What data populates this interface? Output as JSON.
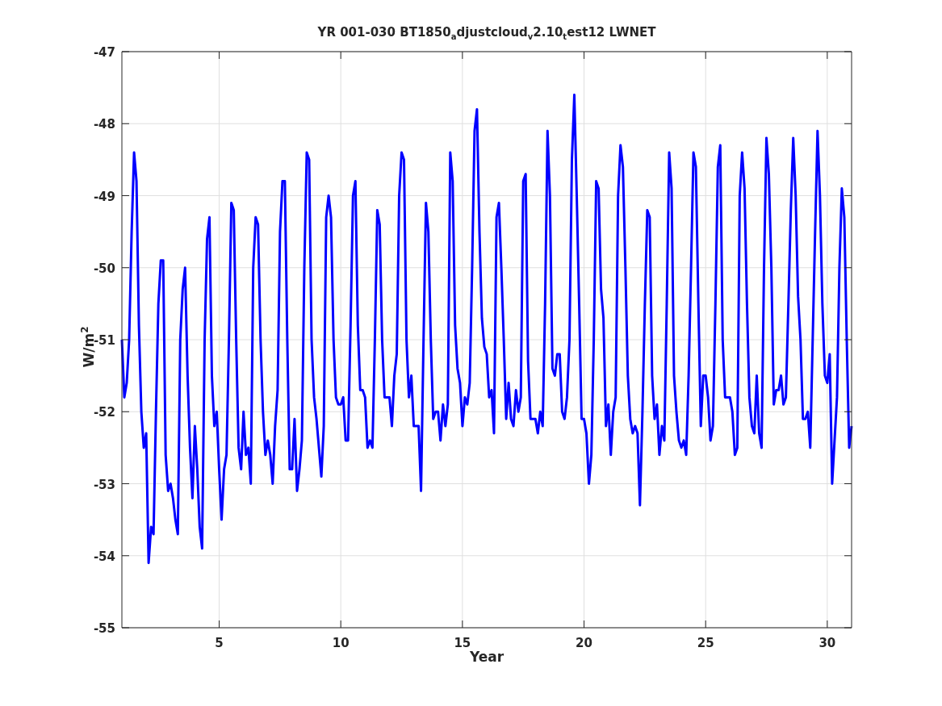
{
  "figure": {
    "chart_data": {
      "type": "line",
      "title": "YR 001-030 BT1850$_{a}$djustcloud$_{v}$2.10$_{t}$est12 LWNET",
      "xlabel": "Year",
      "ylabel": "W/m$^{2}$",
      "xlim": [
        1,
        31
      ],
      "ylim": [
        -55,
        -47
      ],
      "xticks": [
        5,
        10,
        15,
        20,
        25,
        30
      ],
      "yticks": [
        -55,
        -54,
        -53,
        -52,
        -51,
        -50,
        -49,
        -48,
        -47
      ],
      "x": [
        1.0,
        1.1,
        1.2,
        1.3,
        1.4,
        1.5,
        1.6,
        1.7,
        1.8,
        1.9,
        2.0,
        2.1,
        2.2,
        2.3,
        2.4,
        2.5,
        2.6,
        2.7,
        2.8,
        2.9,
        3.0,
        3.1,
        3.2,
        3.3,
        3.4,
        3.5,
        3.6,
        3.7,
        3.8,
        3.9,
        4.0,
        4.1,
        4.2,
        4.3,
        4.4,
        4.5,
        4.6,
        4.7,
        4.8,
        4.9,
        5.0,
        5.1,
        5.2,
        5.3,
        5.4,
        5.5,
        5.6,
        5.7,
        5.8,
        5.9,
        6.0,
        6.1,
        6.2,
        6.3,
        6.4,
        6.5,
        6.6,
        6.7,
        6.8,
        6.9,
        7.0,
        7.1,
        7.2,
        7.3,
        7.4,
        7.5,
        7.6,
        7.7,
        7.8,
        7.9,
        8.0,
        8.1,
        8.2,
        8.3,
        8.4,
        8.5,
        8.6,
        8.7,
        8.8,
        8.9,
        9.0,
        9.1,
        9.2,
        9.3,
        9.4,
        9.5,
        9.6,
        9.7,
        9.8,
        9.9,
        10.0,
        10.1,
        10.2,
        10.3,
        10.4,
        10.5,
        10.6,
        10.7,
        10.8,
        10.9,
        11.0,
        11.1,
        11.2,
        11.3,
        11.4,
        11.5,
        11.6,
        11.7,
        11.8,
        11.9,
        12.0,
        12.1,
        12.2,
        12.3,
        12.4,
        12.5,
        12.6,
        12.7,
        12.8,
        12.9,
        13.0,
        13.1,
        13.2,
        13.3,
        13.4,
        13.5,
        13.6,
        13.7,
        13.8,
        13.9,
        14.0,
        14.1,
        14.2,
        14.3,
        14.4,
        14.5,
        14.6,
        14.7,
        14.8,
        14.9,
        15.0,
        15.1,
        15.2,
        15.3,
        15.4,
        15.5,
        15.6,
        15.7,
        15.8,
        15.9,
        16.0,
        16.1,
        16.2,
        16.3,
        16.4,
        16.5,
        16.6,
        16.7,
        16.8,
        16.9,
        17.0,
        17.1,
        17.2,
        17.3,
        17.4,
        17.5,
        17.6,
        17.7,
        17.8,
        17.9,
        18.0,
        18.1,
        18.2,
        18.3,
        18.4,
        18.5,
        18.6,
        18.7,
        18.8,
        18.9,
        19.0,
        19.1,
        19.2,
        19.3,
        19.4,
        19.5,
        19.6,
        19.7,
        19.8,
        19.9,
        20.0,
        20.1,
        20.2,
        20.3,
        20.4,
        20.5,
        20.6,
        20.7,
        20.8,
        20.9,
        21.0,
        21.1,
        21.2,
        21.3,
        21.4,
        21.5,
        21.6,
        21.7,
        21.8,
        21.9,
        22.0,
        22.1,
        22.2,
        22.3,
        22.4,
        22.5,
        22.6,
        22.7,
        22.8,
        22.9,
        23.0,
        23.1,
        23.2,
        23.3,
        23.4,
        23.5,
        23.6,
        23.7,
        23.8,
        23.9,
        24.0,
        24.1,
        24.2,
        24.3,
        24.4,
        24.5,
        24.6,
        24.7,
        24.8,
        24.9,
        25.0,
        25.1,
        25.2,
        25.3,
        25.4,
        25.5,
        25.6,
        25.7,
        25.8,
        25.9,
        26.0,
        26.1,
        26.2,
        26.3,
        26.4,
        26.5,
        26.6,
        26.7,
        26.8,
        26.9,
        27.0,
        27.1,
        27.2,
        27.3,
        27.4,
        27.5,
        27.6,
        27.7,
        27.8,
        27.9,
        28.0,
        28.1,
        28.2,
        28.3,
        28.4,
        28.5,
        28.6,
        28.7,
        28.8,
        28.9,
        29.0,
        29.1,
        29.2,
        29.3,
        29.4,
        29.5,
        29.6,
        29.7,
        29.8,
        29.9,
        30.0,
        30.1,
        30.2,
        30.3,
        30.4,
        30.5,
        30.6,
        30.7,
        30.8,
        30.9,
        31.0
      ],
      "grid": true,
      "series": [
        {
          "color": "#0000ff",
          "values": [
            -51.0,
            -51.8,
            -51.6,
            -51.0,
            -49.5,
            -48.4,
            -48.8,
            -50.8,
            -52.0,
            -52.5,
            -52.3,
            -54.1,
            -53.6,
            -53.7,
            -52.0,
            -50.5,
            -49.9,
            -49.9,
            -52.6,
            -53.1,
            -53.0,
            -53.2,
            -53.5,
            -53.7,
            -51.0,
            -50.3,
            -50.0,
            -51.5,
            -52.5,
            -53.2,
            -52.2,
            -52.8,
            -53.6,
            -53.9,
            -51.0,
            -49.6,
            -49.3,
            -51.5,
            -52.2,
            -52.0,
            -52.8,
            -53.5,
            -52.8,
            -52.6,
            -51.0,
            -49.1,
            -49.2,
            -51.0,
            -52.5,
            -52.8,
            -52.0,
            -52.6,
            -52.5,
            -53.0,
            -50.0,
            -49.3,
            -49.4,
            -51.0,
            -52.0,
            -52.6,
            -52.4,
            -52.6,
            -53.0,
            -52.2,
            -51.7,
            -49.5,
            -48.8,
            -48.8,
            -51.0,
            -52.8,
            -52.8,
            -52.1,
            -53.1,
            -52.8,
            -52.4,
            -50.0,
            -48.4,
            -48.5,
            -51.0,
            -51.8,
            -52.1,
            -52.5,
            -52.9,
            -52.2,
            -49.3,
            -49.0,
            -49.3,
            -51.0,
            -51.8,
            -51.9,
            -51.9,
            -51.8,
            -52.4,
            -52.4,
            -50.8,
            -49.0,
            -48.8,
            -50.8,
            -51.7,
            -51.7,
            -51.8,
            -52.5,
            -52.4,
            -52.5,
            -51.0,
            -49.2,
            -49.4,
            -51.0,
            -51.8,
            -51.8,
            -51.8,
            -52.2,
            -51.5,
            -51.2,
            -49.0,
            -48.4,
            -48.5,
            -51.0,
            -51.8,
            -51.5,
            -52.2,
            -52.2,
            -52.2,
            -53.1,
            -51.0,
            -49.1,
            -49.5,
            -51.0,
            -52.1,
            -52.0,
            -52.0,
            -52.4,
            -51.9,
            -52.2,
            -51.9,
            -48.4,
            -48.8,
            -50.8,
            -51.4,
            -51.6,
            -52.2,
            -51.8,
            -51.9,
            -51.6,
            -50.0,
            -48.1,
            -47.8,
            -49.5,
            -50.7,
            -51.1,
            -51.2,
            -51.8,
            -51.7,
            -52.3,
            -49.3,
            -49.1,
            -50.0,
            -51.0,
            -52.1,
            -51.6,
            -52.1,
            -52.2,
            -51.7,
            -52.0,
            -51.8,
            -48.8,
            -48.7,
            -51.3,
            -52.1,
            -52.1,
            -52.1,
            -52.3,
            -52.0,
            -52.2,
            -50.5,
            -48.1,
            -49.0,
            -51.4,
            -51.5,
            -51.2,
            -51.2,
            -52.0,
            -52.1,
            -51.8,
            -51.0,
            -48.5,
            -47.6,
            -49.0,
            -50.5,
            -52.1,
            -52.1,
            -52.3,
            -53.0,
            -52.6,
            -51.0,
            -48.8,
            -48.9,
            -50.3,
            -50.7,
            -52.2,
            -51.9,
            -52.6,
            -52.0,
            -51.8,
            -49.0,
            -48.3,
            -48.6,
            -50.0,
            -51.5,
            -52.1,
            -52.3,
            -52.2,
            -52.3,
            -53.3,
            -52.0,
            -50.5,
            -49.2,
            -49.3,
            -51.5,
            -52.1,
            -51.9,
            -52.6,
            -52.2,
            -52.4,
            -50.5,
            -48.4,
            -48.9,
            -51.5,
            -52.0,
            -52.4,
            -52.5,
            -52.4,
            -52.6,
            -51.5,
            -50.0,
            -48.4,
            -48.6,
            -50.5,
            -52.2,
            -51.5,
            -51.5,
            -51.8,
            -52.4,
            -52.2,
            -50.5,
            -48.6,
            -48.3,
            -51.0,
            -51.8,
            -51.8,
            -51.8,
            -52.0,
            -52.6,
            -52.5,
            -49.0,
            -48.4,
            -48.9,
            -50.5,
            -51.8,
            -52.2,
            -52.3,
            -51.5,
            -52.3,
            -52.5,
            -50.0,
            -48.2,
            -48.7,
            -50.0,
            -51.9,
            -51.7,
            -51.7,
            -51.5,
            -51.9,
            -51.8,
            -50.5,
            -49.2,
            -48.2,
            -49.0,
            -50.4,
            -51.0,
            -52.1,
            -52.1,
            -52.0,
            -52.5,
            -51.0,
            -49.5,
            -48.1,
            -49.0,
            -50.5,
            -51.5,
            -51.6,
            -51.2,
            -53.0,
            -52.4,
            -51.8,
            -50.0,
            -48.9,
            -49.3,
            -51.0,
            -52.5,
            -52.2
          ]
        }
      ]
    }
  }
}
